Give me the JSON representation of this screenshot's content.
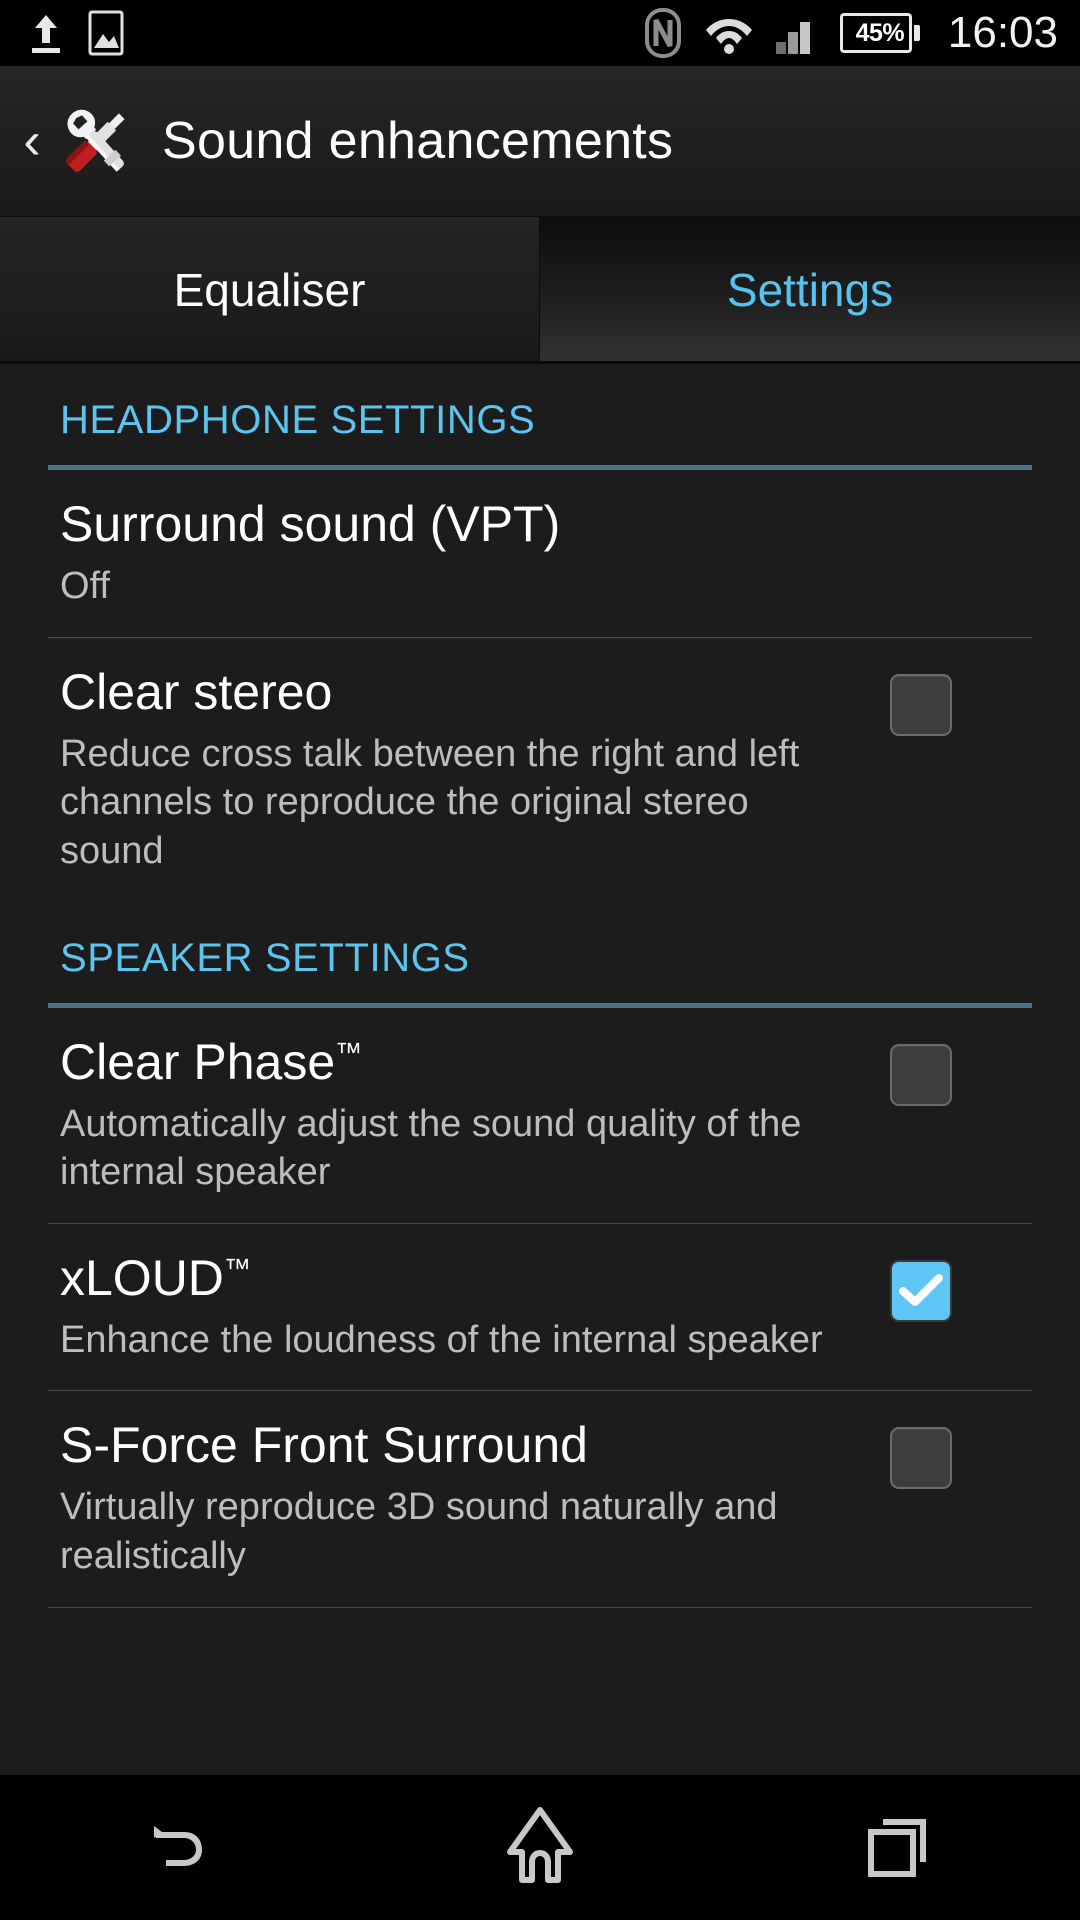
{
  "status_bar": {
    "left_icons": [
      "upload-icon",
      "screenshot-image-icon"
    ],
    "right_icons": [
      "nfc-icon",
      "wifi-icon",
      "cellular-signal-icon"
    ],
    "battery_percent": "45%",
    "time": "16:03"
  },
  "action_bar": {
    "back_label": "‹",
    "icon": "tools-wrench-screwdriver-icon",
    "title": "Sound enhancements"
  },
  "tabs": [
    {
      "label": "Equaliser",
      "active": false
    },
    {
      "label": "Settings",
      "active": true
    }
  ],
  "colors": {
    "accent_blue": "#5cc4ee",
    "checkbox_checked": "#5ec5f5",
    "section_rule": "#4a7287",
    "title_text": "#ffffff",
    "subtitle_text": "#bdbdbd",
    "background": "#1c1c1c",
    "nav_icon": "#c8c8c8"
  },
  "sections": [
    {
      "header": "HEADPHONE SETTINGS",
      "items": [
        {
          "title": "Surround sound (VPT)",
          "subtitle": "Off",
          "has_checkbox": false,
          "checked": false,
          "trademark": false
        },
        {
          "title": "Clear stereo",
          "subtitle": "Reduce cross talk between the right and left channels to reproduce the original stereo sound",
          "has_checkbox": true,
          "checked": false,
          "trademark": false
        }
      ]
    },
    {
      "header": "SPEAKER SETTINGS",
      "items": [
        {
          "title": "Clear Phase",
          "subtitle": "Automatically adjust the sound quality of the internal speaker",
          "has_checkbox": true,
          "checked": false,
          "trademark": true
        },
        {
          "title": "xLOUD",
          "subtitle": "Enhance the loudness of the internal speaker",
          "has_checkbox": true,
          "checked": true,
          "trademark": true
        },
        {
          "title": "S-Force Front Surround",
          "subtitle": "Virtually reproduce 3D sound naturally and realistically",
          "has_checkbox": true,
          "checked": false,
          "trademark": false
        }
      ]
    }
  ],
  "nav_bar": {
    "buttons": [
      {
        "name": "back-icon"
      },
      {
        "name": "home-icon"
      },
      {
        "name": "recents-icon"
      }
    ]
  }
}
